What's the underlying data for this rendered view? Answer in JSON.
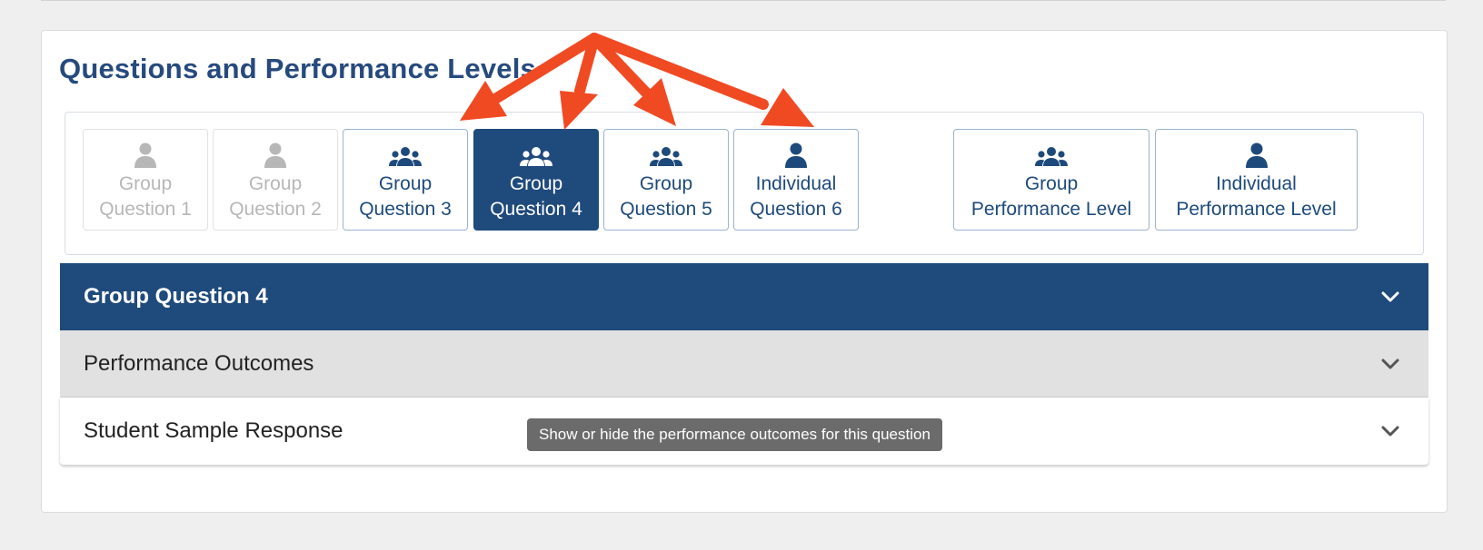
{
  "page": {
    "title": "Questions and Performance Levels"
  },
  "questions": [
    {
      "line1": "Group",
      "line2": "Question 1",
      "icon": "person-icon",
      "state": "disabled"
    },
    {
      "line1": "Group",
      "line2": "Question 2",
      "icon": "person-icon",
      "state": "disabled"
    },
    {
      "line1": "Group",
      "line2": "Question 3",
      "icon": "group-icon",
      "state": "enabled"
    },
    {
      "line1": "Group",
      "line2": "Question 4",
      "icon": "group-icon",
      "state": "active"
    },
    {
      "line1": "Group",
      "line2": "Question 5",
      "icon": "group-icon",
      "state": "enabled"
    },
    {
      "line1": "Individual",
      "line2": "Question 6",
      "icon": "person-icon",
      "state": "enabled"
    }
  ],
  "levels": [
    {
      "line1": "Group",
      "line2": "Performance Level",
      "icon": "group-icon"
    },
    {
      "line1": "Individual",
      "line2": "Performance Level",
      "icon": "person-icon"
    }
  ],
  "accordion": {
    "group_question": "Group Question 4",
    "performance_outcomes": "Performance Outcomes",
    "student_sample": "Student Sample Response"
  },
  "tooltip": {
    "text": "Show or hide the performance outcomes for this question"
  },
  "colors": {
    "brand": "#1f4a7c",
    "title": "#264a7d",
    "disabled": "#b7b7b7",
    "annotation_arrow": "#f04a23",
    "tooltip_bg": "#6b6b6b"
  }
}
